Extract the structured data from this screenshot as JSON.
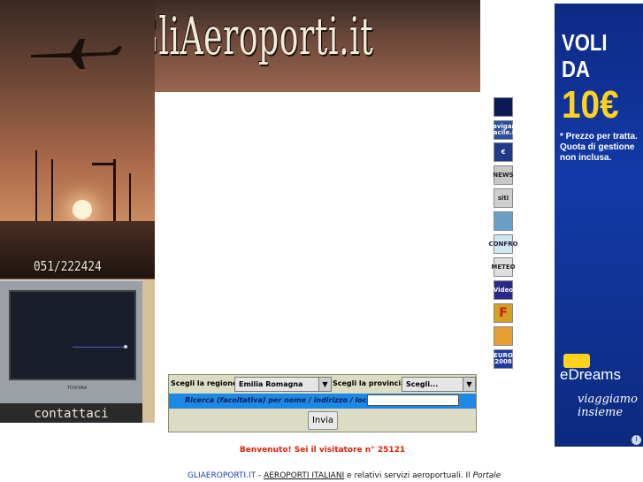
{
  "header": {
    "logo_text": "GliAeroporti.it"
  },
  "left_panel": {
    "phone": "051/222424",
    "tv_brand": "TOSHIBA",
    "contact_label": "contattaci"
  },
  "side_icons": [
    {
      "name": "airplane-icon",
      "label": "",
      "color": "#0b1a55"
    },
    {
      "name": "navigare-facile-icon",
      "label": "Navigare Facile.it",
      "color": "#2a4fa0"
    },
    {
      "name": "euro-icon",
      "label": "€",
      "color": "#1f3a8a"
    },
    {
      "name": "news-icon",
      "label": "NEWS",
      "color": "#c8c8c8"
    },
    {
      "name": "siti-icon",
      "label": "siti",
      "color": "#cfcfcf"
    },
    {
      "name": "globe-icon",
      "label": "",
      "color": "#6aa0c8"
    },
    {
      "name": "confronto-icon",
      "label": "CONFRO",
      "color": "#d0e8f0"
    },
    {
      "name": "meteo-icon",
      "label": "METEO",
      "color": "#e0e0e0"
    },
    {
      "name": "video-icon",
      "label": "Video",
      "color": "#2a2a8a"
    },
    {
      "name": "f-logo-icon",
      "label": "F",
      "color": "#d6a020"
    },
    {
      "name": "calendar-icon",
      "label": "",
      "color": "#e8a030"
    },
    {
      "name": "euro-2008-icon",
      "label": "EURO 2008",
      "color": "#1e3aa0"
    }
  ],
  "ad": {
    "line1": "VOLI",
    "line2": "DA",
    "price": "10€",
    "note": "* Prezzo per tratta. Quota di gestione non inclusa.",
    "brand": "eDreams",
    "tagline": "viaggiamo insieme",
    "info": "i"
  },
  "form": {
    "region_label": "Scegli la regione",
    "region_value": "Emilia Romagna",
    "province_label": "Scegli la provincia",
    "province_value": "Scegli...",
    "search_label": "Ricerca (facoltativa) per nome / indirizzo / località",
    "search_value": "",
    "submit": "Invia"
  },
  "welcome": "Benvenuto! Sei il visitatore n° 25121",
  "footer": {
    "site": "GLIAEROPORTI.IT",
    "sep": " - ",
    "link": "AEROPORTI ITALIANI",
    "text": " e relativi servizi aeroportuali. Il ",
    "tail": "Portale"
  },
  "colors": {
    "accent_blue": "#1e88e5",
    "welcome_red": "#e0220a",
    "ad_yellow": "#ffd21c"
  }
}
